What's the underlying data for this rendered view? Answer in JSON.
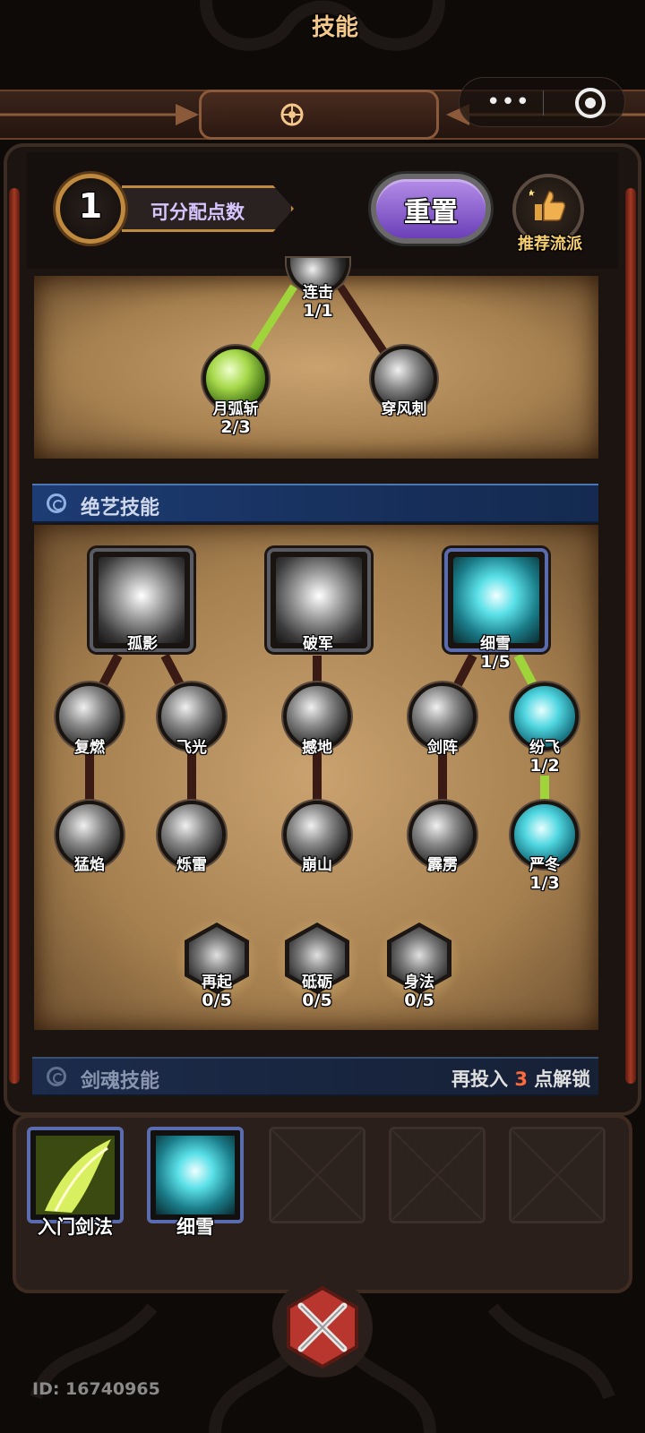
{
  "title": "技能",
  "colors": {
    "accent_gold": "#c08a3e",
    "reset_purple": "#7d4fd0",
    "path_active": "#9fd43a",
    "path_inactive": "#3a1a14",
    "section_blue": "#1d3c74"
  },
  "miniapp": {
    "more_icon": "three-dots-icon",
    "close_icon": "target-ring-icon"
  },
  "points": {
    "value": "1",
    "label": "可分配点数"
  },
  "reset": {
    "label": "重置"
  },
  "recommend": {
    "label": "推荐流派",
    "icon": "thumbs-up-icon"
  },
  "top_tree": {
    "root": {
      "name": "连击",
      "count": "1/1"
    },
    "children": [
      {
        "name": "月弧斩",
        "count": "2/3",
        "style": "green"
      },
      {
        "name": "穿风刺",
        "count": "",
        "style": "gray"
      }
    ]
  },
  "ultimate": {
    "title": "绝艺技能",
    "columns": [
      {
        "name": "孤影",
        "count": "",
        "style": "gray"
      },
      {
        "name": "破军",
        "count": "",
        "style": "gray"
      },
      {
        "name": "细雪",
        "count": "1/5",
        "style": "cyan"
      }
    ],
    "row1": [
      {
        "name": "复燃",
        "count": ""
      },
      {
        "name": "飞光",
        "count": ""
      },
      {
        "name": "撼地",
        "count": ""
      },
      {
        "name": "剑阵",
        "count": ""
      },
      {
        "name": "纷飞",
        "count": "1/2"
      }
    ],
    "row2": [
      {
        "name": "猛焰",
        "count": ""
      },
      {
        "name": "烁雷",
        "count": ""
      },
      {
        "name": "崩山",
        "count": ""
      },
      {
        "name": "霹雳",
        "count": ""
      },
      {
        "name": "严冬",
        "count": "1/3"
      }
    ],
    "passives": [
      {
        "name": "再起",
        "count": "0/5"
      },
      {
        "name": "砥砺",
        "count": "0/5"
      },
      {
        "name": "身法",
        "count": "0/5"
      }
    ]
  },
  "soul": {
    "title": "剑魂技能",
    "hint_prefix": "再投入",
    "hint_num": "3",
    "hint_suffix": "点解锁"
  },
  "slots": [
    {
      "name": "入门剑法",
      "filled": true
    },
    {
      "name": "细雪",
      "filled": true
    },
    {
      "name": "",
      "filled": false
    },
    {
      "name": "",
      "filled": false
    },
    {
      "name": "",
      "filled": false
    }
  ],
  "id_text": "ID: 16740965"
}
